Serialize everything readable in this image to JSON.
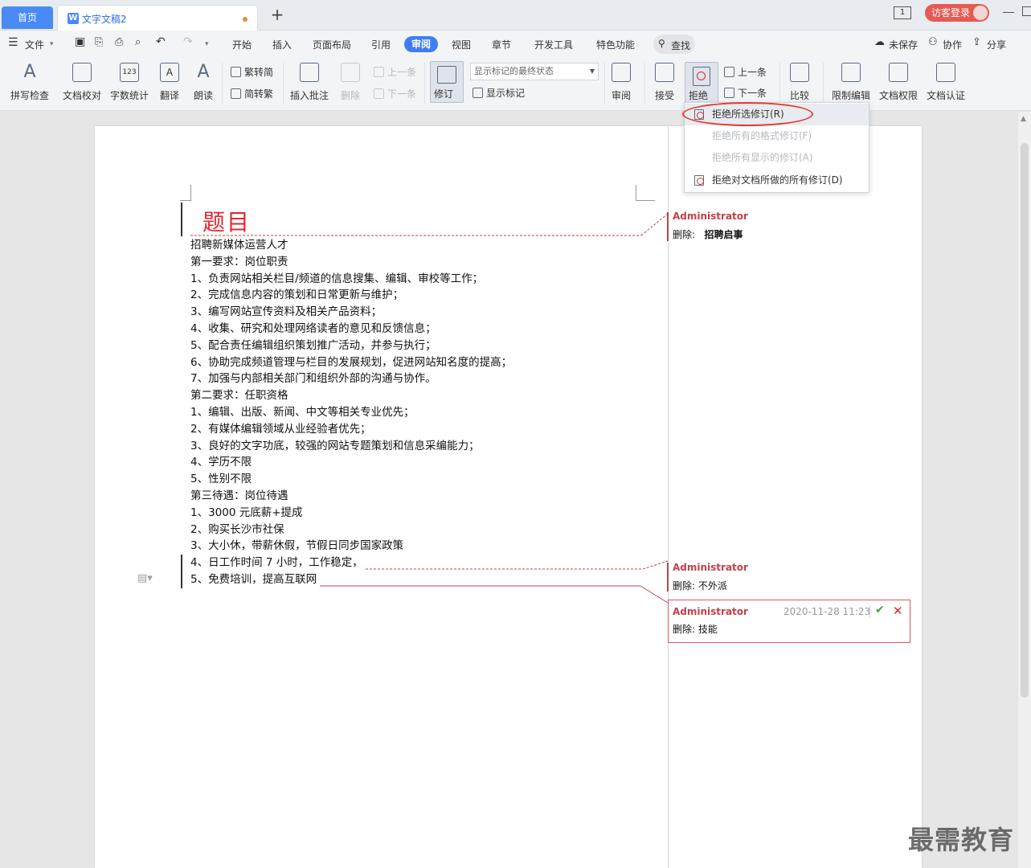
{
  "tabs": {
    "home": "首页",
    "doc": "文字文稿2",
    "add": "+"
  },
  "window": {
    "num": "1",
    "login": "访客登录"
  },
  "menu": {
    "file": "文件",
    "items": [
      "开始",
      "插入",
      "页面布局",
      "引用",
      "审阅",
      "视图",
      "章节",
      "开发工具",
      "特色功能"
    ],
    "search": "查找",
    "unsaved": "未保存",
    "collab": "协作",
    "share": "分享"
  },
  "ribbon": {
    "spell": "拼写检查",
    "doccheck": "文档校对",
    "wordcount": "字数统计",
    "translate": "翻译",
    "read": "朗读",
    "trad2simp": "繁转简",
    "simp2trad": "简转繁",
    "insert_comment": "插入批注",
    "delete": "删除",
    "prev_comment": "上一条",
    "next_comment": "下一条",
    "revise": "修订",
    "display_combo": "显示标记的最终状态",
    "show_markup": "显示标记",
    "review": "审阅",
    "accept": "接受",
    "reject": "拒绝",
    "prev": "上一条",
    "next": "下一条",
    "compare": "比较",
    "restrict": "限制编辑",
    "perm": "文档权限",
    "cert": "文档认证"
  },
  "dropdown": {
    "items": [
      {
        "label": "拒绝所选修订(R)",
        "enabled": true
      },
      {
        "label": "拒绝所有的格式修订(F)",
        "enabled": false
      },
      {
        "label": "拒绝所有显示的修订(A)",
        "enabled": false
      },
      {
        "label": "拒绝对文档所做的所有修订(D)",
        "enabled": true
      }
    ]
  },
  "document": {
    "title": "题目",
    "lines": [
      "招聘新媒体运营人才",
      "第一要求：岗位职责",
      "1、负责网站相关栏目/频道的信息搜集、编辑、审校等工作；",
      "2、完成信息内容的策划和日常更新与维护；",
      "3、编写网站宣传资料及相关产品资料；",
      "4、收集、研究和处理网络读者的意见和反馈信息；",
      "5、配合责任编辑组织策划推广活动，并参与执行；",
      "6、协助完成频道管理与栏目的发展规划，促进网站知名度的提高；",
      "7、加强与内部相关部门和组织外部的沟通与协作。",
      "第二要求：任职资格",
      "1、编辑、出版、新闻、中文等相关专业优先；",
      "2、有媒体编辑领域从业经验者优先；",
      "3、良好的文字功底，较强的网站专题策划和信息采编能力；",
      "4、学历不限",
      "5、性别不限",
      "第三待遇：岗位待遇",
      "1、3000 元底薪+提成",
      "2、购买长沙市社保",
      "3、大小休，带薪休假，节假日同步国家政策",
      "4、日工作时间 7 小时，工作稳定，",
      "5、免费培训，提高互联网"
    ]
  },
  "comments": [
    {
      "author": "Administrator",
      "label": "删除:",
      "text": "招聘启事"
    },
    {
      "author": "Administrator",
      "label": "删除:",
      "text": "不外派"
    },
    {
      "author": "Administrator",
      "label": "删除:",
      "text": "技能",
      "time": "2020-11-28 11:23"
    }
  ],
  "watermark": "最需教育",
  "colors": {
    "accent": "#3f7ef0",
    "revision": "#c4414a",
    "title": "#e3262e",
    "highlight_oval": "#e33a35"
  }
}
